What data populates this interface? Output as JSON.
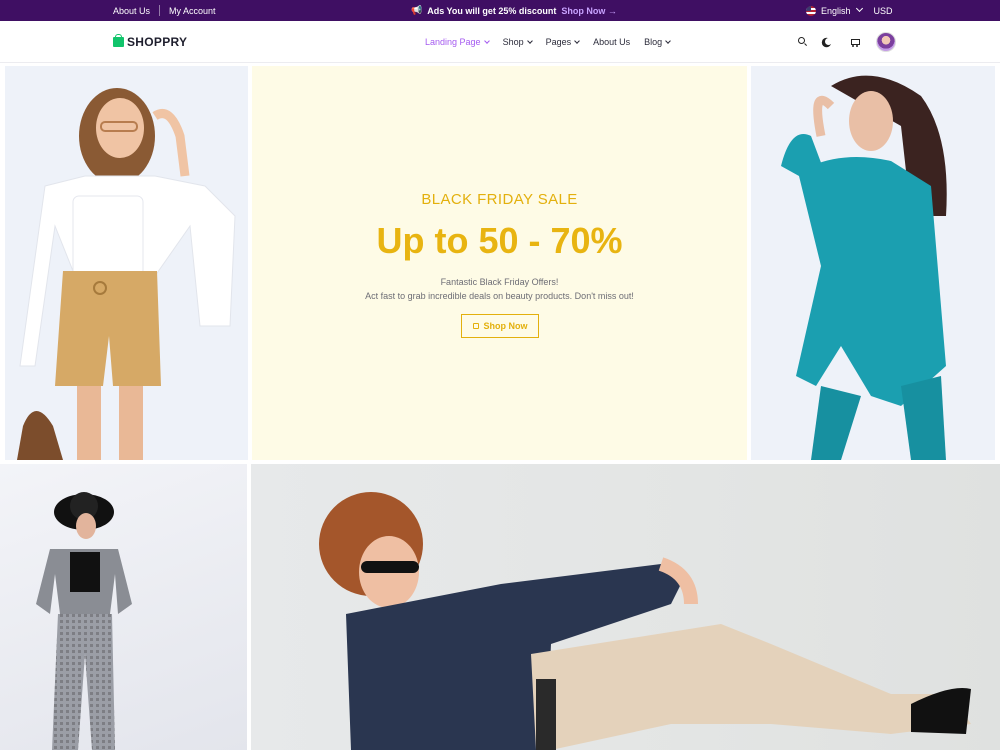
{
  "topbar": {
    "about": "About Us",
    "account": "My Account",
    "promo_text": "Ads You will get 25% discount",
    "promo_link": "Shop Now →",
    "language": "English",
    "currency": "USD"
  },
  "header": {
    "logo": "SHOPPRY",
    "nav": [
      {
        "label": "Landing Page",
        "active": true
      },
      {
        "label": "Shop"
      },
      {
        "label": "Pages"
      },
      {
        "label": "About Us"
      },
      {
        "label": "Blog"
      }
    ],
    "icons": [
      "search-icon",
      "moon-icon",
      "cart-icon",
      "avatar"
    ]
  },
  "banner": {
    "subtitle": "BLACK FRIDAY SALE",
    "title": "Up to 50 - 70%",
    "line1": "Fantastic Black Friday Offers!",
    "line2": "Act fast to grab incredible deals on beauty products. Don't miss out!",
    "button": "Shop Now"
  },
  "colors": {
    "topbar": "#3f0f63",
    "accent_nav": "#a55bf0",
    "banner_yellow": "#e3b00d",
    "banner_bg": "#fefbe6",
    "logo_green": "#11c46b"
  }
}
